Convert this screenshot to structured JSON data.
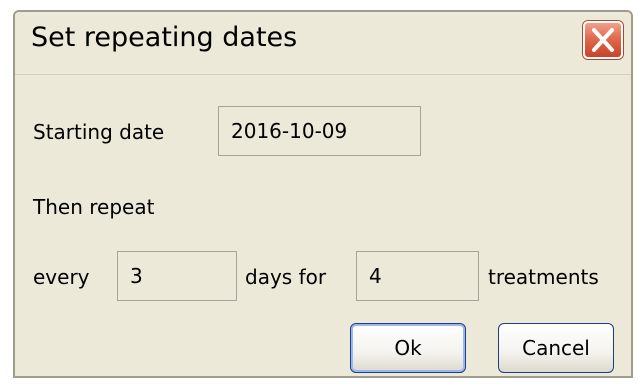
{
  "dialog": {
    "title": "Set repeating dates",
    "close_icon": "close-icon"
  },
  "form": {
    "starting_date_label": "Starting date",
    "starting_date_value": "2016-10-09",
    "then_repeat_label": "Then repeat",
    "every_label": "every",
    "every_value": "3",
    "days_for_label": "days for",
    "count_value": "4",
    "treatments_label": "treatments"
  },
  "buttons": {
    "ok_label": "Ok",
    "cancel_label": "Cancel"
  },
  "colors": {
    "dialog_background": "#ece9d8",
    "close_button_red": "#e06a4c",
    "button_border": "#1f3c88"
  }
}
